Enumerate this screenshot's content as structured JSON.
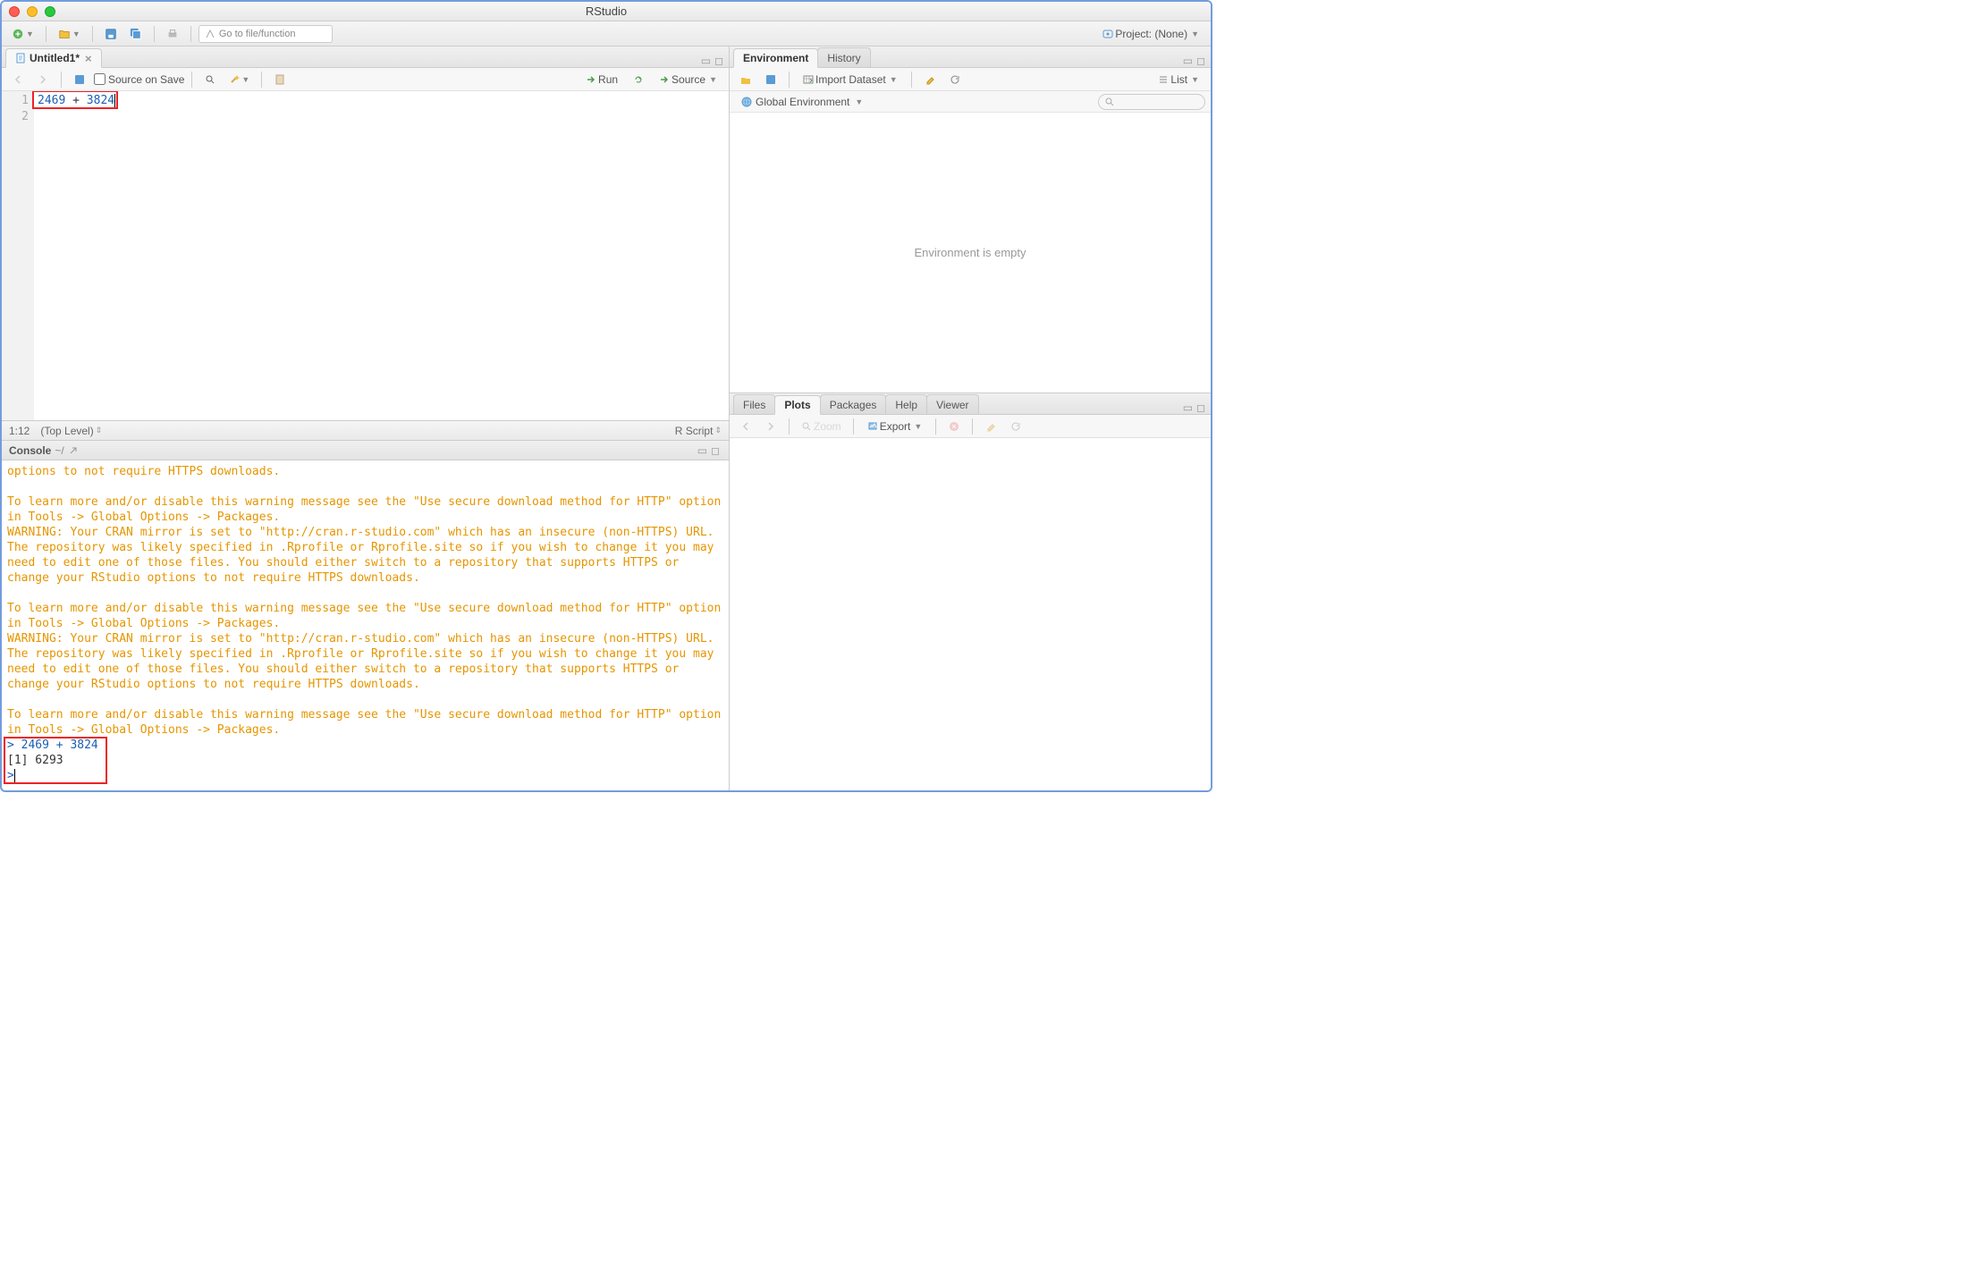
{
  "window": {
    "title": "RStudio"
  },
  "main_toolbar": {
    "goto_placeholder": "Go to file/function",
    "project_label": "Project: (None)"
  },
  "source": {
    "tab_name": "Untitled1*",
    "source_on_save": "Source on Save",
    "run_label": "Run",
    "source_label": "Source",
    "code_lines": [
      "2469 + 3824",
      ""
    ],
    "status": {
      "pos": "1:12",
      "scope": "(Top Level)",
      "type": "R Script"
    }
  },
  "console": {
    "title": "Console",
    "path": "~/",
    "messages": [
      "options to not require HTTPS downloads.",
      "",
      "To learn more and/or disable this warning message see the \"Use secure download method for HTTP\" option in Tools -> Global Options -> Packages.",
      "WARNING: Your CRAN mirror is set to \"http://cran.r-studio.com\" which has an insecure (non-HTTPS) URL. The repository was likely specified in .Rprofile or Rprofile.site so if you wish to change it you may need to edit one of those files. You should either switch to a repository that supports HTTPS or change your RStudio options to not require HTTPS downloads.",
      "",
      "To learn more and/or disable this warning message see the \"Use secure download method for HTTP\" option in Tools -> Global Options -> Packages.",
      "WARNING: Your CRAN mirror is set to \"http://cran.r-studio.com\" which has an insecure (non-HTTPS) URL. The repository was likely specified in .Rprofile or Rprofile.site so if you wish to change it you may need to edit one of those files. You should either switch to a repository that supports HTTPS or change your RStudio options to not require HTTPS downloads.",
      "",
      "To learn more and/or disable this warning message see the \"Use secure download method for HTTP\" option in Tools -> Global Options -> Packages."
    ],
    "input_line": "> 2469 + 3824",
    "output_line": "[1] 6293",
    "prompt": ">"
  },
  "environment": {
    "tabs": [
      "Environment",
      "History"
    ],
    "import_label": "Import Dataset",
    "list_label": "List",
    "scope_label": "Global Environment",
    "empty_msg": "Environment is empty"
  },
  "files_pane": {
    "tabs": [
      "Files",
      "Plots",
      "Packages",
      "Help",
      "Viewer"
    ],
    "zoom_label": "Zoom",
    "export_label": "Export"
  }
}
